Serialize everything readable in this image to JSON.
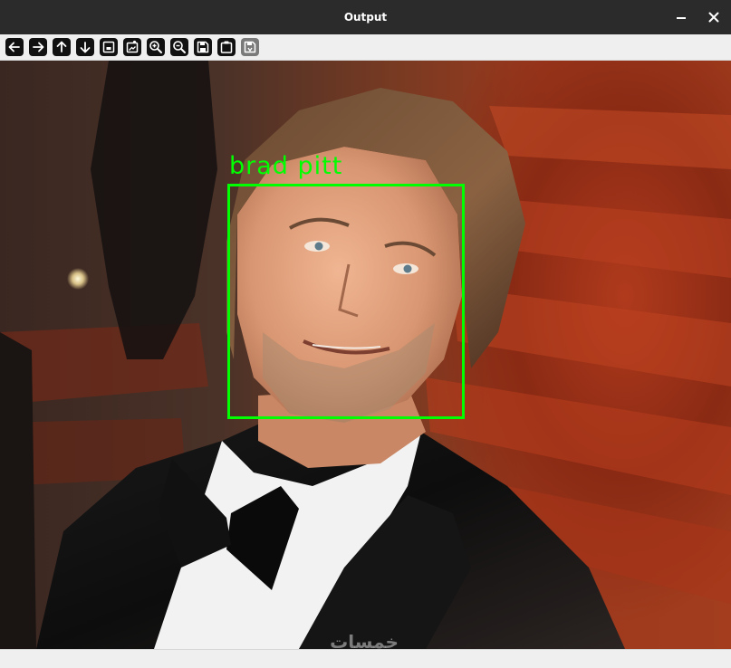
{
  "window": {
    "title": "Output",
    "controls": {
      "minimize": "minimize",
      "close": "close"
    }
  },
  "toolbar": {
    "buttons": [
      {
        "name": "arrow-left-icon",
        "label": "Pan left"
      },
      {
        "name": "arrow-right-icon",
        "label": "Pan right"
      },
      {
        "name": "arrow-up-icon",
        "label": "Pan up"
      },
      {
        "name": "arrow-down-icon",
        "label": "Pan down"
      },
      {
        "name": "zoom-original-icon",
        "label": "Zoom original"
      },
      {
        "name": "zoom-fit-icon",
        "label": "Zoom fit"
      },
      {
        "name": "zoom-in-icon",
        "label": "Zoom in"
      },
      {
        "name": "zoom-out-icon",
        "label": "Zoom out"
      },
      {
        "name": "save-icon",
        "label": "Save"
      },
      {
        "name": "copy-clipboard-icon",
        "label": "Copy"
      },
      {
        "name": "properties-icon",
        "label": "Properties"
      }
    ]
  },
  "image": {
    "detection": {
      "label": "brad pitt",
      "color": "#00ff00"
    },
    "watermark": "خمسات"
  },
  "colors": {
    "titlebar": "#2b2b2b",
    "toolbar": "#efefef",
    "box": "#00ff00"
  }
}
